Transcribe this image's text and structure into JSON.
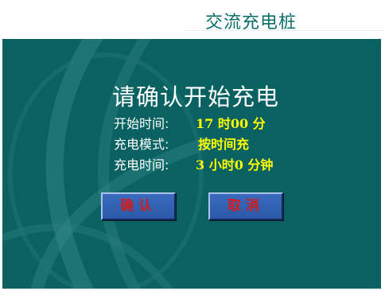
{
  "header": {
    "title": "交流充电桩"
  },
  "dialog": {
    "prompt": "请确认开始充电",
    "start_time": {
      "label": "开始时间:",
      "value": "17 时00 分"
    },
    "charge_mode": {
      "label": "充电模式:",
      "value": "按时间充"
    },
    "charge_duration": {
      "label": "充电时间:",
      "value": "3 小时0 分钟"
    },
    "confirm_label": "确认",
    "cancel_label": "取消"
  },
  "colors": {
    "background_teal": "#0a6161",
    "value_yellow": "#ffff00",
    "button_blue": "#3262b3",
    "button_text_red": "#d21c1c",
    "header_title": "#0d6f6a"
  }
}
